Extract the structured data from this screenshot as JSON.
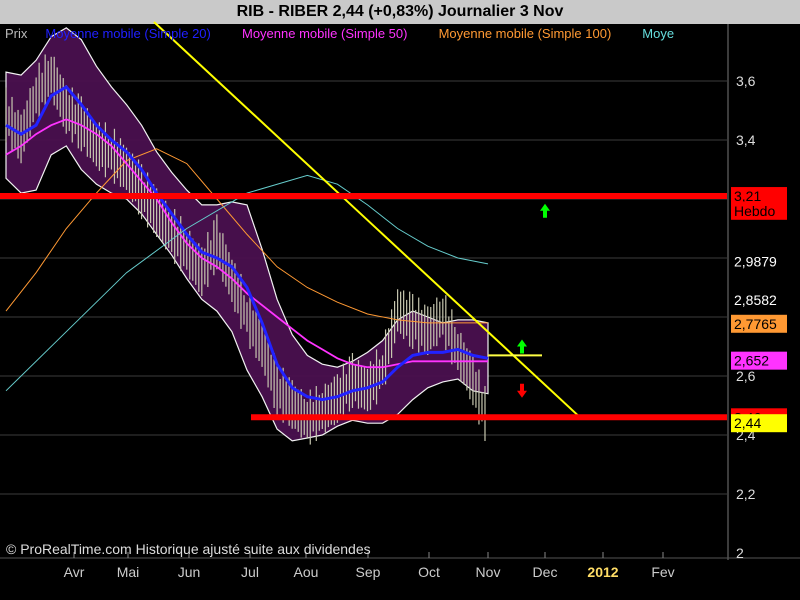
{
  "header": {
    "title": "RIB - RIBER     2,44 (+0,83%)     Journalier  3 Nov"
  },
  "legend": [
    {
      "label": "Prix",
      "color": "#bbbbbb"
    },
    {
      "label": "Moyenne mobile (Simple 20)",
      "color": "#2020ff"
    },
    {
      "label": "Moyenne mobile (Simple 50)",
      "color": "#ff33ff"
    },
    {
      "label": "Moyenne mobile (Simple 100)",
      "color": "#ff9933"
    },
    {
      "label": "Moye",
      "color": "#66dddd"
    }
  ],
  "copyright": "© ProRealTime.com Historique ajusté suite aux dividendes",
  "chart_data": {
    "type": "line",
    "title": "RIB - RIBER     2,44 (+0,83%)     Journalier  3 Nov",
    "ylim": [
      2.0,
      3.8
    ],
    "y_ticks": [
      "3,6",
      "3,4",
      "2,6",
      "2,2",
      "2"
    ],
    "y_tick_values": [
      3.6,
      3.4,
      2.6,
      2.2,
      2.0
    ],
    "y_tick_partial": [
      {
        "label": "2,4",
        "value": 2.4
      }
    ],
    "x_labels": [
      "Avr",
      "Mai",
      "Jun",
      "Jul",
      "Aou",
      "Sep",
      "Oct",
      "Nov",
      "Dec",
      "2012",
      "Fev"
    ],
    "price_labels": [
      {
        "label": "3,21",
        "value": 3.21,
        "bg": "#ff0000",
        "fg": "#000000"
      },
      {
        "label": "Hebdo",
        "value": 3.16,
        "bg": "#ff0000",
        "fg": "#000000"
      },
      {
        "label": "2,9879",
        "value": 2.988,
        "bg": "#000000",
        "fg": "#ffffff"
      },
      {
        "label": "2,8582",
        "value": 2.858,
        "bg": "#000000",
        "fg": "#ffffff"
      },
      {
        "label": "2,7765",
        "value": 2.777,
        "bg": "#ff9933",
        "fg": "#000000"
      },
      {
        "label": "2,652",
        "value": 2.652,
        "bg": "#ff33ff",
        "fg": "#000000"
      },
      {
        "label": "2,46",
        "value": 2.46,
        "bg": "#ff0000",
        "fg": "#000000"
      },
      {
        "label": "2,44",
        "value": 2.44,
        "bg": "#ffff00",
        "fg": "#000000"
      }
    ],
    "horizontal_lines": [
      {
        "value": 3.21,
        "color": "#ff0000",
        "x_start": "Mar",
        "x_end": "end"
      },
      {
        "value": 2.46,
        "color": "#ff0000",
        "x_start": "Jul",
        "x_end": "end"
      },
      {
        "value": 2.67,
        "color": "#ffff44",
        "x_start": "Nov",
        "x_end": "Nov"
      }
    ],
    "trendline": {
      "from": {
        "x": "Avr",
        "y": 3.8
      },
      "to": {
        "x": "Dec",
        "y": 2.46
      },
      "color": "#ffff00"
    },
    "arrows": [
      {
        "x": "Dec",
        "y": 3.16,
        "direction": "up",
        "color": "#00ff00"
      },
      {
        "x": "Nov",
        "y": 2.7,
        "direction": "up",
        "color": "#00ff00"
      },
      {
        "x": "Nov",
        "y": 2.55,
        "direction": "down",
        "color": "#ff0000"
      }
    ],
    "series": [
      {
        "name": "Prix",
        "x": [
          0,
          5,
          10,
          15,
          20,
          25,
          30,
          35,
          40,
          45,
          50,
          55,
          60,
          65,
          70,
          75,
          80,
          85,
          90,
          95,
          100,
          105,
          110,
          115,
          120,
          125,
          130,
          135,
          140,
          145,
          150,
          155,
          160
        ],
        "values": [
          3.48,
          3.4,
          3.55,
          3.62,
          3.5,
          3.45,
          3.38,
          3.35,
          3.3,
          3.22,
          3.15,
          3.08,
          3.02,
          2.95,
          3.05,
          2.92,
          2.8,
          2.7,
          2.55,
          2.5,
          2.45,
          2.48,
          2.52,
          2.58,
          2.55,
          2.62,
          2.82,
          2.78,
          2.75,
          2.8,
          2.68,
          2.58,
          2.44
        ]
      },
      {
        "name": "Moyenne mobile (Simple 20)",
        "x": [
          0,
          5,
          10,
          15,
          20,
          25,
          30,
          35,
          40,
          45,
          50,
          55,
          60,
          65,
          70,
          75,
          80,
          85,
          90,
          95,
          100,
          105,
          110,
          115,
          120,
          125,
          130,
          135,
          140,
          145,
          150,
          155,
          160
        ],
        "values": [
          3.45,
          3.42,
          3.45,
          3.55,
          3.58,
          3.52,
          3.45,
          3.4,
          3.36,
          3.3,
          3.22,
          3.15,
          3.08,
          3.02,
          3.0,
          2.97,
          2.9,
          2.78,
          2.64,
          2.56,
          2.53,
          2.52,
          2.53,
          2.55,
          2.56,
          2.58,
          2.63,
          2.67,
          2.68,
          2.68,
          2.69,
          2.67,
          2.66
        ]
      },
      {
        "name": "Moyenne mobile (Simple 50)",
        "x": [
          0,
          5,
          10,
          15,
          20,
          25,
          30,
          35,
          40,
          45,
          50,
          55,
          60,
          65,
          70,
          75,
          80,
          85,
          90,
          95,
          100,
          105,
          110,
          115,
          120,
          125,
          130,
          135,
          140,
          145,
          150,
          155,
          160
        ],
        "values": [
          3.35,
          3.38,
          3.42,
          3.45,
          3.47,
          3.45,
          3.42,
          3.38,
          3.32,
          3.26,
          3.2,
          3.12,
          3.05,
          3.0,
          2.97,
          2.93,
          2.88,
          2.84,
          2.8,
          2.76,
          2.72,
          2.69,
          2.66,
          2.64,
          2.63,
          2.63,
          2.64,
          2.65,
          2.65,
          2.65,
          2.65,
          2.65,
          2.65
        ]
      },
      {
        "name": "Moyenne mobile (Simple 100)",
        "x": [
          0,
          10,
          20,
          30,
          40,
          50,
          60,
          70,
          80,
          90,
          100,
          110,
          120,
          130,
          140,
          150,
          160
        ],
        "values": [
          2.82,
          2.95,
          3.1,
          3.22,
          3.33,
          3.37,
          3.32,
          3.2,
          3.08,
          2.97,
          2.9,
          2.85,
          2.81,
          2.79,
          2.78,
          2.78,
          2.78
        ]
      }
    ]
  }
}
